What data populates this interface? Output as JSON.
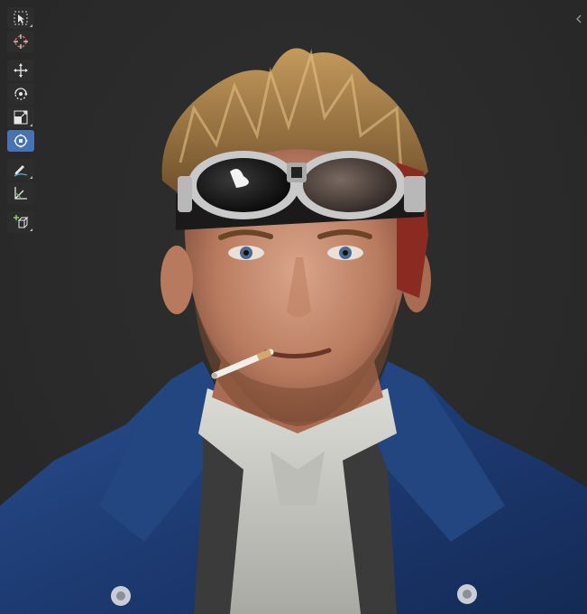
{
  "viewport": {
    "background": "#2b2b2b",
    "subject": "character-render"
  },
  "toolbar": {
    "active_tool": "transform",
    "accent": "#4772b3",
    "tools": [
      {
        "name": "select-box",
        "icon": "select-box-icon"
      },
      {
        "name": "cursor",
        "icon": "cursor-icon"
      },
      {
        "name": "move",
        "icon": "move-icon"
      },
      {
        "name": "rotate",
        "icon": "rotate-icon"
      },
      {
        "name": "scale",
        "icon": "scale-icon"
      },
      {
        "name": "transform",
        "icon": "transform-icon"
      },
      {
        "name": "annotate",
        "icon": "annotate-icon"
      },
      {
        "name": "measure",
        "icon": "measure-icon"
      },
      {
        "name": "add-cube",
        "icon": "add-cube-icon"
      }
    ]
  },
  "sidebar_toggle": {
    "icon": "chevron-left-icon"
  }
}
